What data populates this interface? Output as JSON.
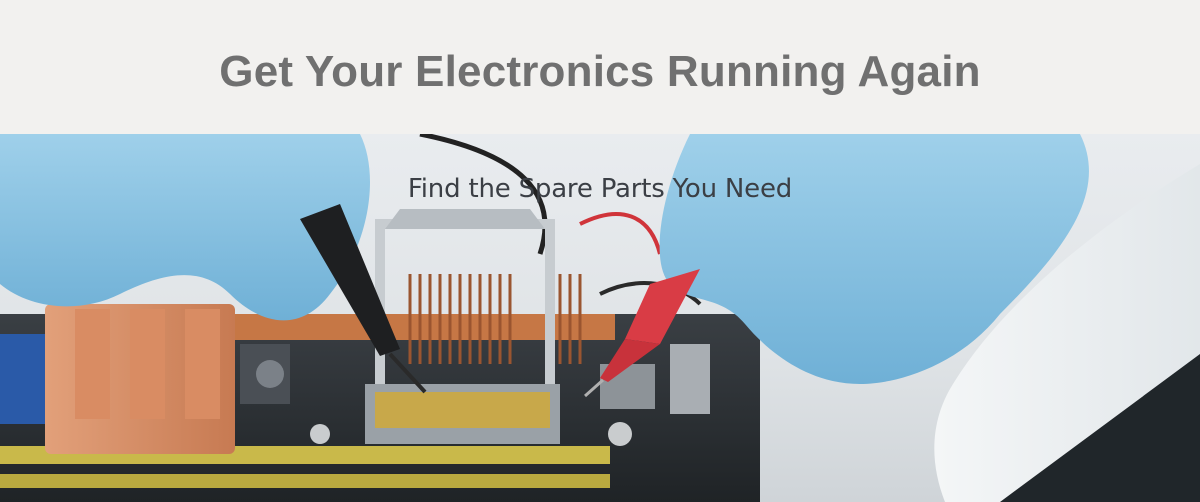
{
  "header": {
    "title": "Get Your Electronics Running Again"
  },
  "hero": {
    "subtitle": "Find the Spare Parts You Need",
    "image_icon": "electronics-repair-photo"
  },
  "colors": {
    "header_bg": "#f2f1ef",
    "title_color": "#707070",
    "subtitle_color": "#3b3f45"
  }
}
